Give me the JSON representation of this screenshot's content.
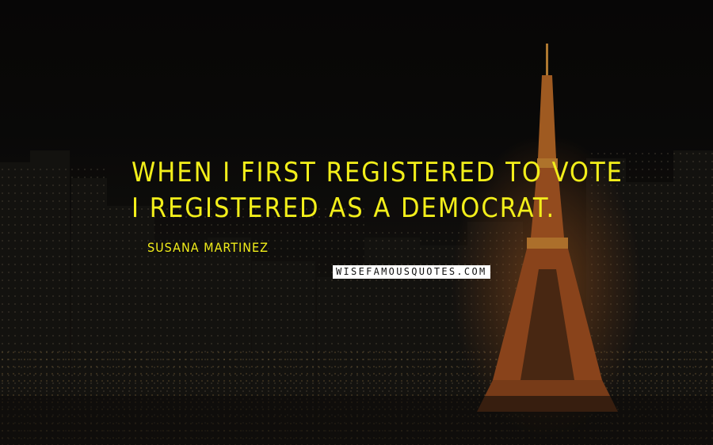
{
  "quote": {
    "text": "When I first registered to vote I registered as a Democrat.",
    "author": "Susana Martinez"
  },
  "watermark": {
    "text": "wisefamousquotes.com"
  },
  "colors": {
    "quote_text": "#f2ee1a",
    "background": "#0b0a09",
    "tower_light": "#d8752b"
  },
  "background_image": {
    "subject": "night-city-skyline-with-illuminated-tower-icon"
  }
}
